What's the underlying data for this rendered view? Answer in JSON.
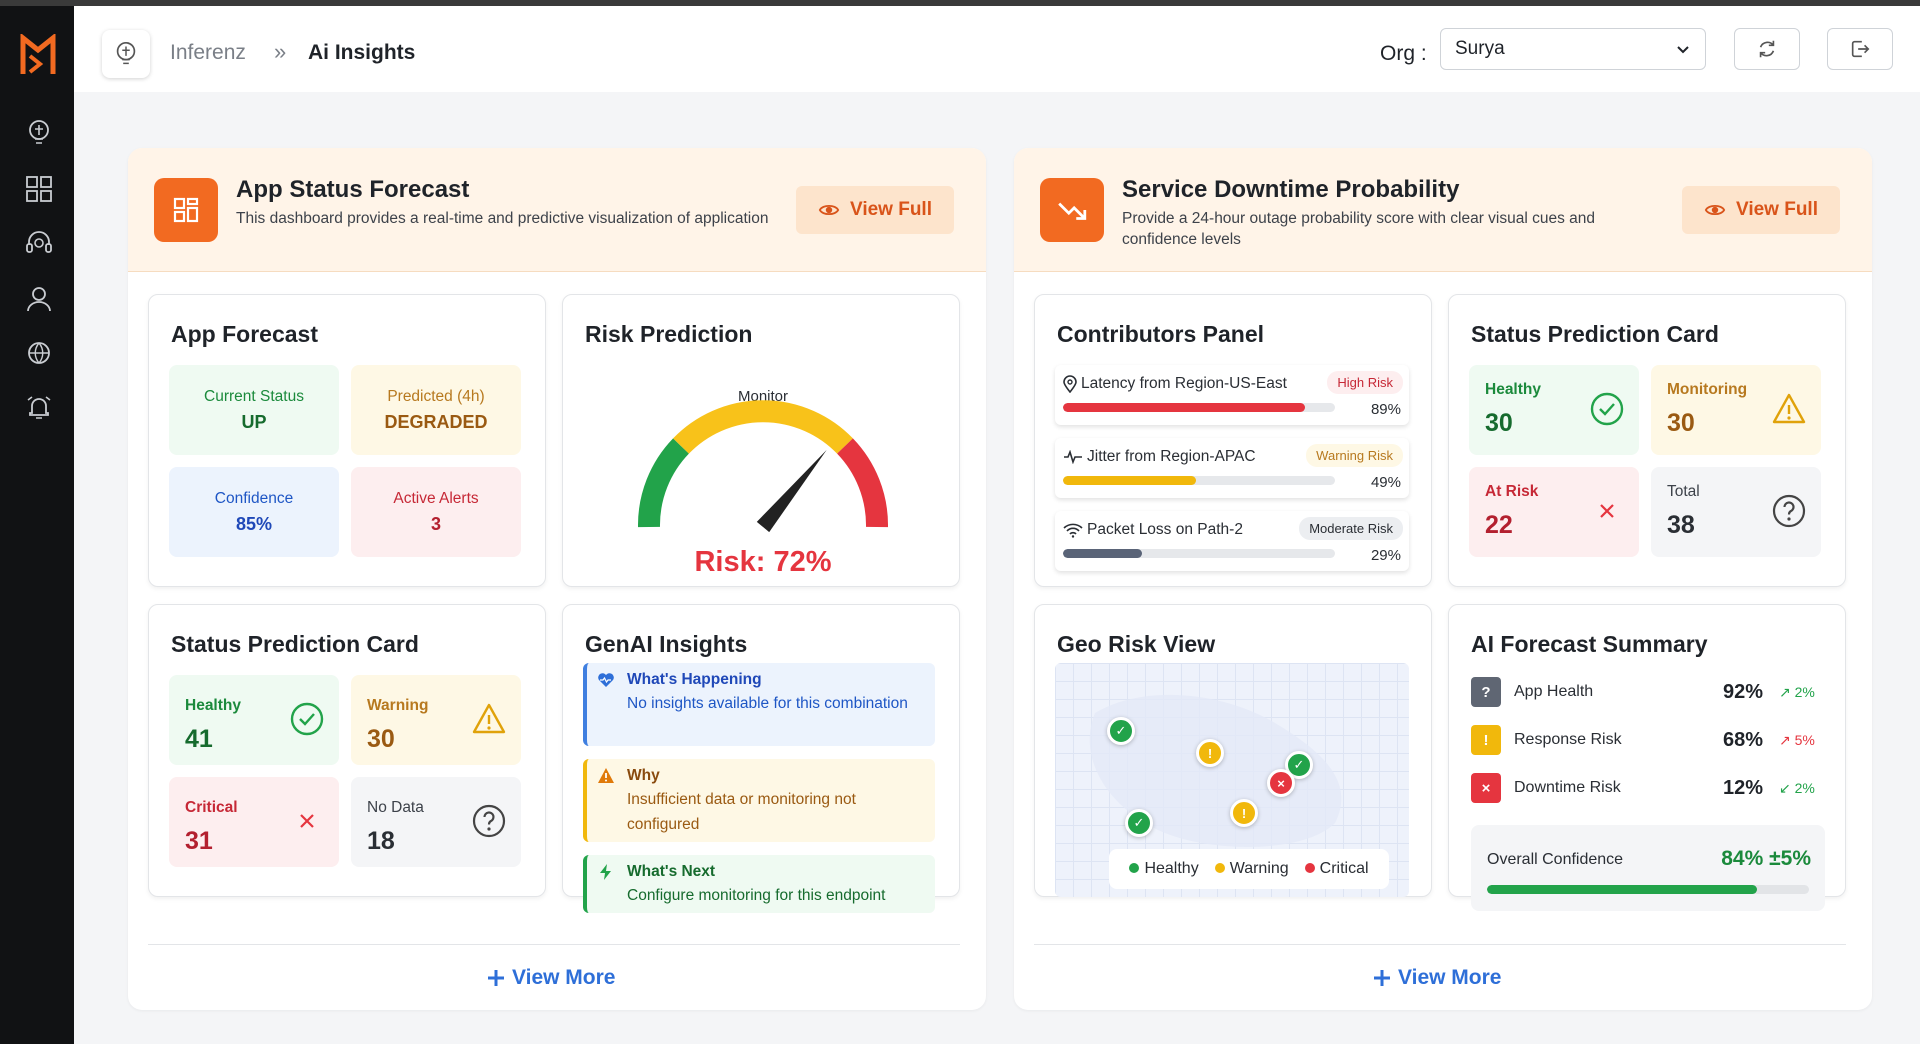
{
  "breadcrumb": {
    "root": "Inferenz",
    "separator": "»",
    "page": "Ai Insights"
  },
  "org": {
    "label": "Org :",
    "selected": "Surya"
  },
  "panels": {
    "left": {
      "title": "App Status Forecast",
      "description": "This dashboard provides a real-time and predictive visualization of application",
      "view_full": "View Full",
      "view_more": "View More",
      "app_forecast": {
        "title": "App Forecast",
        "tiles": [
          {
            "label": "Current Status",
            "value": "UP"
          },
          {
            "label": "Predicted (4h)",
            "value": "DEGRADED"
          },
          {
            "label": "Confidence",
            "value": "85%"
          },
          {
            "label": "Active Alerts",
            "value": "3"
          }
        ]
      },
      "risk_prediction": {
        "title": "Risk Prediction",
        "gauge_label": "Monitor",
        "risk_text": "Risk: 72%",
        "risk_value": 72
      },
      "status_card": {
        "title": "Status Prediction Card",
        "tiles": [
          {
            "label": "Healthy",
            "value": "41"
          },
          {
            "label": "Warning",
            "value": "30"
          },
          {
            "label": "Critical",
            "value": "31"
          },
          {
            "label": "No Data",
            "value": "18"
          }
        ]
      },
      "genai": {
        "title": "GenAI Insights",
        "items": [
          {
            "title": "What's Happening",
            "text": "No insights available for this combination"
          },
          {
            "title": "Why",
            "text": "Insufficient data or monitoring not configured"
          },
          {
            "title": "What's Next",
            "text": "Configure monitoring for this endpoint"
          }
        ]
      }
    },
    "right": {
      "title": "Service Downtime Probability",
      "description": "Provide a 24-hour outage probability score with clear visual cues and confidence levels",
      "view_full": "View Full",
      "view_more": "View More",
      "contributors": {
        "title": "Contributors Panel",
        "items": [
          {
            "label": "Latency from Region-US-East",
            "badge": "High Risk",
            "percent_text": "89%",
            "percent": 89,
            "color": "#e5353f"
          },
          {
            "label": "Jitter from Region-APAC",
            "badge": "Warning Risk",
            "percent_text": "49%",
            "percent": 49,
            "color": "#f1b80c"
          },
          {
            "label": "Packet Loss on Path-2",
            "badge": "Moderate Risk",
            "percent_text": "29%",
            "percent": 29,
            "color": "#5a6478"
          }
        ]
      },
      "status_card": {
        "title": "Status Prediction Card",
        "tiles": [
          {
            "label": "Healthy",
            "value": "30"
          },
          {
            "label": "Monitoring",
            "value": "30"
          },
          {
            "label": "At Risk",
            "value": "22"
          },
          {
            "label": "Total",
            "value": "38"
          }
        ]
      },
      "geo": {
        "title": "Geo Risk View",
        "legend": {
          "healthy": "Healthy",
          "warning": "Warning",
          "critical": "Critical"
        }
      },
      "ai_summary": {
        "title": "AI Forecast Summary",
        "rows": [
          {
            "label": "App Health",
            "value": "92%",
            "trend": "2%",
            "icon": "question-icon"
          },
          {
            "label": "Response Risk",
            "value": "68%",
            "trend": "5%",
            "icon": "warning-icon"
          },
          {
            "label": "Downtime Risk",
            "value": "12%",
            "trend": "2%",
            "icon": "close-icon"
          }
        ],
        "confidence_label": "Overall Confidence",
        "confidence_value": "84% ±5%",
        "confidence_percent": 84
      }
    }
  },
  "colors": {
    "accent": "#f26a21",
    "healthy": "#22a34a",
    "warning": "#f1b80c",
    "critical": "#e5353f",
    "link": "#2e6fd8"
  }
}
